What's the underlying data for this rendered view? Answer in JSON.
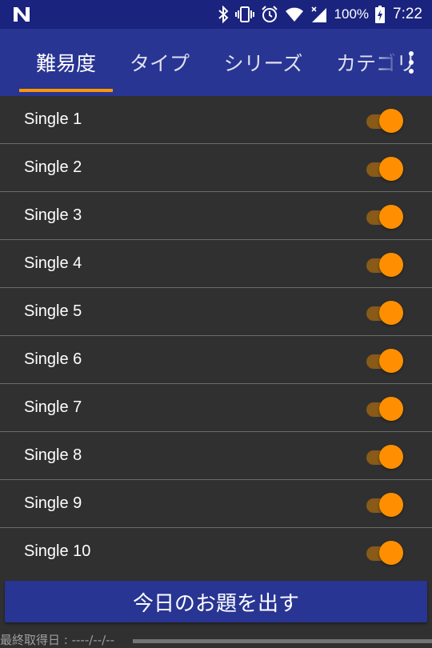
{
  "status_bar": {
    "battery": "100%",
    "time": "7:22",
    "icons": [
      "n-notification-icon",
      "bluetooth-icon",
      "vibrate-icon",
      "alarm-icon",
      "wifi-icon",
      "cell-signal-icon",
      "battery-charging-icon"
    ]
  },
  "tabs": [
    {
      "label": "難易度",
      "selected": true
    },
    {
      "label": "タイプ",
      "selected": false
    },
    {
      "label": "シリーズ",
      "selected": false
    },
    {
      "label": "カテゴリ",
      "selected": false
    }
  ],
  "items": [
    {
      "label": "Single 1",
      "enabled": true
    },
    {
      "label": "Single 2",
      "enabled": true
    },
    {
      "label": "Single 3",
      "enabled": true
    },
    {
      "label": "Single 4",
      "enabled": true
    },
    {
      "label": "Single 5",
      "enabled": true
    },
    {
      "label": "Single 6",
      "enabled": true
    },
    {
      "label": "Single 7",
      "enabled": true
    },
    {
      "label": "Single 8",
      "enabled": true
    },
    {
      "label": "Single 9",
      "enabled": true
    },
    {
      "label": "Single 10",
      "enabled": true
    }
  ],
  "action_button": {
    "label": "今日のお題を出す"
  },
  "footer": {
    "last_fetched": "最終取得日 : ----/--/--"
  },
  "colors": {
    "status_bar": "#1a237e",
    "app_bar": "#283593",
    "accent": "#ff8f00",
    "background": "#303030"
  }
}
